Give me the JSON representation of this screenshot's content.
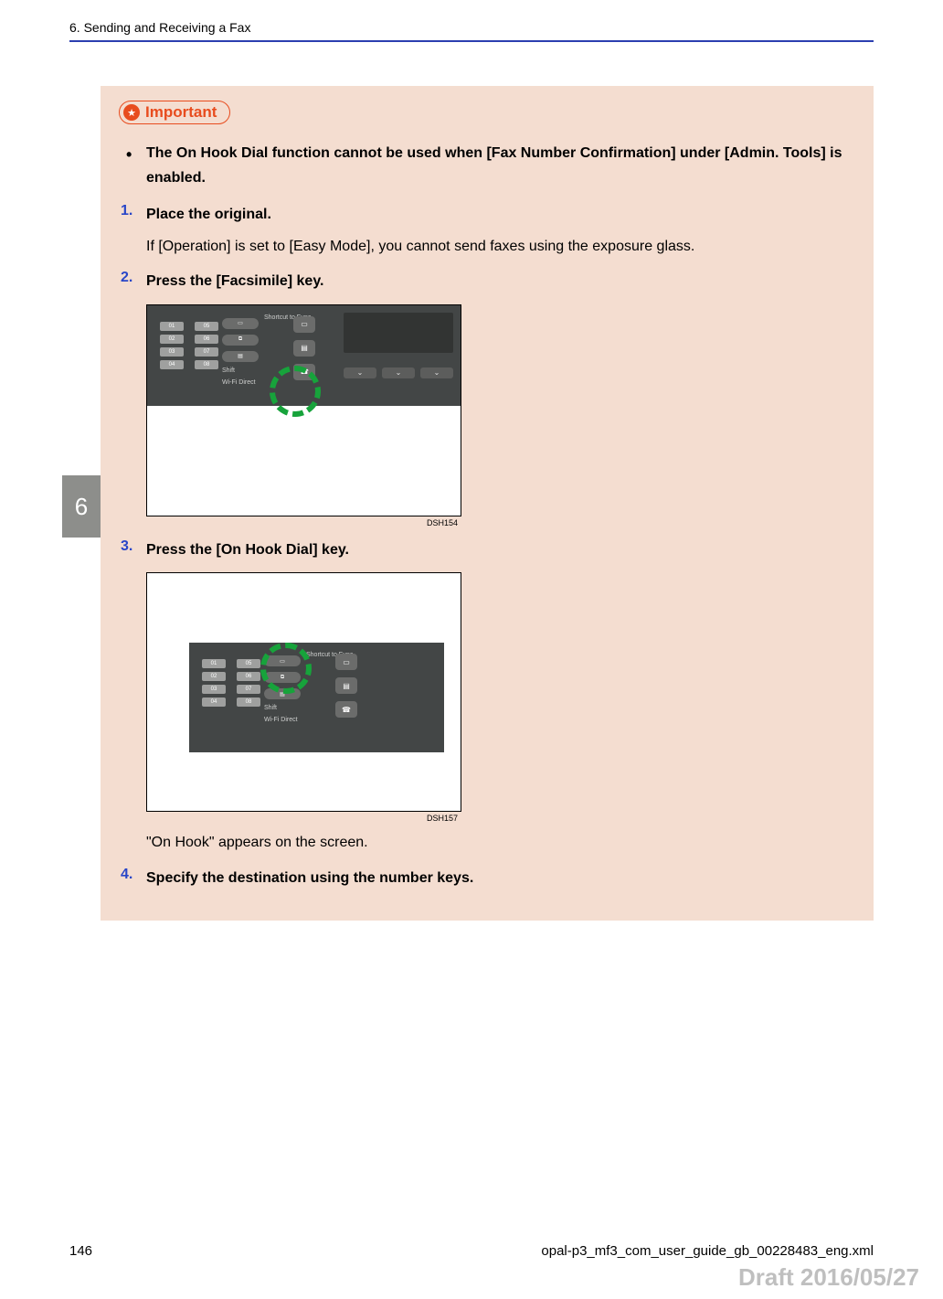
{
  "header": {
    "chapter": "6. Sending and Receiving a Fax"
  },
  "tab": {
    "num": "6"
  },
  "important": {
    "label": "Important",
    "bullet": "The On Hook Dial function cannot be used when [Fax Number Confirmation] under [Admin. Tools] is enabled."
  },
  "steps": [
    {
      "num": "1.",
      "title": "Place the original.",
      "body": "If [Operation] is set to [Easy Mode], you cannot send faxes using the exposure glass."
    },
    {
      "num": "2.",
      "title": "Press the [Facsimile] key.",
      "diagram_label": "DSH154"
    },
    {
      "num": "3.",
      "title": "Press the [On Hook Dial] key.",
      "diagram_label": "DSH157",
      "body_after": "\"On Hook\" appears on the screen."
    },
    {
      "num": "4.",
      "title": "Specify the destination using the number keys."
    }
  ],
  "panel_labels": {
    "k01": "01",
    "k05": "05",
    "k02": "02",
    "k06": "06",
    "k03": "03",
    "k07": "07",
    "k04": "04",
    "k08": "08",
    "shortcut": "Shortcut to Func.",
    "shift": "Shift",
    "wifi": "Wi-Fi Direct"
  },
  "footer": {
    "page": "146",
    "file": "opal-p3_mf3_com_user_guide_gb_00228483_eng.xml",
    "draft": "Draft 2016/05/27"
  }
}
